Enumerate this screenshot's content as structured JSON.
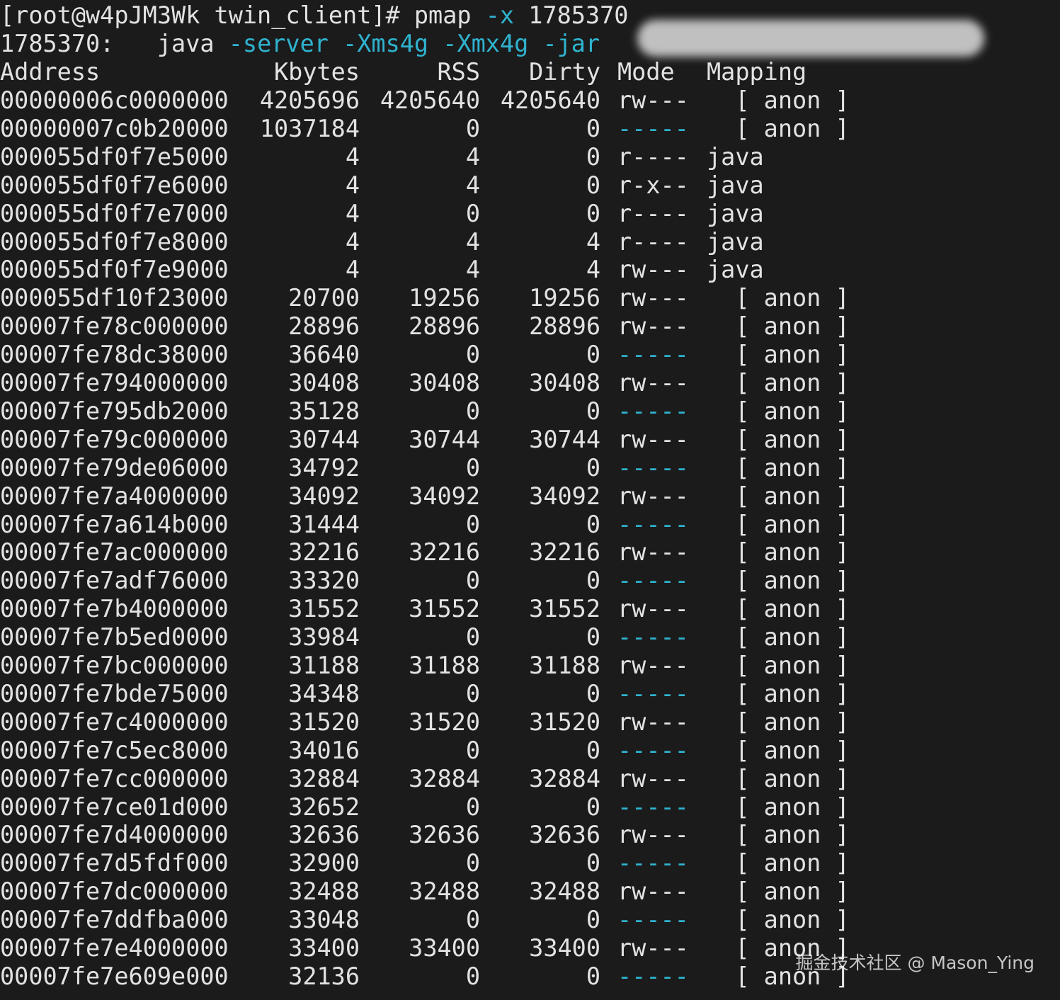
{
  "terminal": {
    "prompt_line": "[root@w4pJM3Wk twin_client]# pmap ",
    "prompt_flag": "-x",
    "prompt_pid": " 1785370",
    "cmd_pid": "1785370:",
    "cmd_prog": "java",
    "cmd_args": [
      "-server",
      "-Xms4g",
      "-Xmx4g",
      "-jar"
    ],
    "headers": {
      "address": "Address",
      "kbytes": "Kbytes",
      "rss": "RSS",
      "dirty": "Dirty",
      "mode": "Mode",
      "mapping": "Mapping"
    },
    "rows": [
      {
        "address": "00000006c0000000",
        "kbytes": "4205696",
        "rss": "4205640",
        "dirty": "4205640",
        "mode": "rw---",
        "mapping": "  [ anon ]"
      },
      {
        "address": "00000007c0b20000",
        "kbytes": "1037184",
        "rss": "0",
        "dirty": "0",
        "mode": "-----",
        "mapping": "  [ anon ]"
      },
      {
        "address": "000055df0f7e5000",
        "kbytes": "4",
        "rss": "4",
        "dirty": "0",
        "mode": "r----",
        "mapping": "java"
      },
      {
        "address": "000055df0f7e6000",
        "kbytes": "4",
        "rss": "4",
        "dirty": "0",
        "mode": "r-x--",
        "mapping": "java"
      },
      {
        "address": "000055df0f7e7000",
        "kbytes": "4",
        "rss": "0",
        "dirty": "0",
        "mode": "r----",
        "mapping": "java"
      },
      {
        "address": "000055df0f7e8000",
        "kbytes": "4",
        "rss": "4",
        "dirty": "4",
        "mode": "r----",
        "mapping": "java"
      },
      {
        "address": "000055df0f7e9000",
        "kbytes": "4",
        "rss": "4",
        "dirty": "4",
        "mode": "rw---",
        "mapping": "java"
      },
      {
        "address": "000055df10f23000",
        "kbytes": "20700",
        "rss": "19256",
        "dirty": "19256",
        "mode": "rw---",
        "mapping": "  [ anon ]"
      },
      {
        "address": "00007fe78c000000",
        "kbytes": "28896",
        "rss": "28896",
        "dirty": "28896",
        "mode": "rw---",
        "mapping": "  [ anon ]"
      },
      {
        "address": "00007fe78dc38000",
        "kbytes": "36640",
        "rss": "0",
        "dirty": "0",
        "mode": "-----",
        "mapping": "  [ anon ]"
      },
      {
        "address": "00007fe794000000",
        "kbytes": "30408",
        "rss": "30408",
        "dirty": "30408",
        "mode": "rw---",
        "mapping": "  [ anon ]"
      },
      {
        "address": "00007fe795db2000",
        "kbytes": "35128",
        "rss": "0",
        "dirty": "0",
        "mode": "-----",
        "mapping": "  [ anon ]"
      },
      {
        "address": "00007fe79c000000",
        "kbytes": "30744",
        "rss": "30744",
        "dirty": "30744",
        "mode": "rw---",
        "mapping": "  [ anon ]"
      },
      {
        "address": "00007fe79de06000",
        "kbytes": "34792",
        "rss": "0",
        "dirty": "0",
        "mode": "-----",
        "mapping": "  [ anon ]"
      },
      {
        "address": "00007fe7a4000000",
        "kbytes": "34092",
        "rss": "34092",
        "dirty": "34092",
        "mode": "rw---",
        "mapping": "  [ anon ]"
      },
      {
        "address": "00007fe7a614b000",
        "kbytes": "31444",
        "rss": "0",
        "dirty": "0",
        "mode": "-----",
        "mapping": "  [ anon ]"
      },
      {
        "address": "00007fe7ac000000",
        "kbytes": "32216",
        "rss": "32216",
        "dirty": "32216",
        "mode": "rw---",
        "mapping": "  [ anon ]"
      },
      {
        "address": "00007fe7adf76000",
        "kbytes": "33320",
        "rss": "0",
        "dirty": "0",
        "mode": "-----",
        "mapping": "  [ anon ]"
      },
      {
        "address": "00007fe7b4000000",
        "kbytes": "31552",
        "rss": "31552",
        "dirty": "31552",
        "mode": "rw---",
        "mapping": "  [ anon ]"
      },
      {
        "address": "00007fe7b5ed0000",
        "kbytes": "33984",
        "rss": "0",
        "dirty": "0",
        "mode": "-----",
        "mapping": "  [ anon ]"
      },
      {
        "address": "00007fe7bc000000",
        "kbytes": "31188",
        "rss": "31188",
        "dirty": "31188",
        "mode": "rw---",
        "mapping": "  [ anon ]"
      },
      {
        "address": "00007fe7bde75000",
        "kbytes": "34348",
        "rss": "0",
        "dirty": "0",
        "mode": "-----",
        "mapping": "  [ anon ]"
      },
      {
        "address": "00007fe7c4000000",
        "kbytes": "31520",
        "rss": "31520",
        "dirty": "31520",
        "mode": "rw---",
        "mapping": "  [ anon ]"
      },
      {
        "address": "00007fe7c5ec8000",
        "kbytes": "34016",
        "rss": "0",
        "dirty": "0",
        "mode": "-----",
        "mapping": "  [ anon ]"
      },
      {
        "address": "00007fe7cc000000",
        "kbytes": "32884",
        "rss": "32884",
        "dirty": "32884",
        "mode": "rw---",
        "mapping": "  [ anon ]"
      },
      {
        "address": "00007fe7ce01d000",
        "kbytes": "32652",
        "rss": "0",
        "dirty": "0",
        "mode": "-----",
        "mapping": "  [ anon ]"
      },
      {
        "address": "00007fe7d4000000",
        "kbytes": "32636",
        "rss": "32636",
        "dirty": "32636",
        "mode": "rw---",
        "mapping": "  [ anon ]"
      },
      {
        "address": "00007fe7d5fdf000",
        "kbytes": "32900",
        "rss": "0",
        "dirty": "0",
        "mode": "-----",
        "mapping": "  [ anon ]"
      },
      {
        "address": "00007fe7dc000000",
        "kbytes": "32488",
        "rss": "32488",
        "dirty": "32488",
        "mode": "rw---",
        "mapping": "  [ anon ]"
      },
      {
        "address": "00007fe7ddfba000",
        "kbytes": "33048",
        "rss": "0",
        "dirty": "0",
        "mode": "-----",
        "mapping": "  [ anon ]"
      },
      {
        "address": "00007fe7e4000000",
        "kbytes": "33400",
        "rss": "33400",
        "dirty": "33400",
        "mode": "rw---",
        "mapping": "  [ anon ]"
      },
      {
        "address": "00007fe7e609e000",
        "kbytes": "32136",
        "rss": "0",
        "dirty": "0",
        "mode": "-----",
        "mapping": "  [ anon ]"
      }
    ]
  },
  "watermark": "掘金技术社区 @ Mason_Ying",
  "colors": {
    "background": "#1b1b1b",
    "foreground": "#e2e2e2",
    "accent": "#2fb3cf"
  }
}
